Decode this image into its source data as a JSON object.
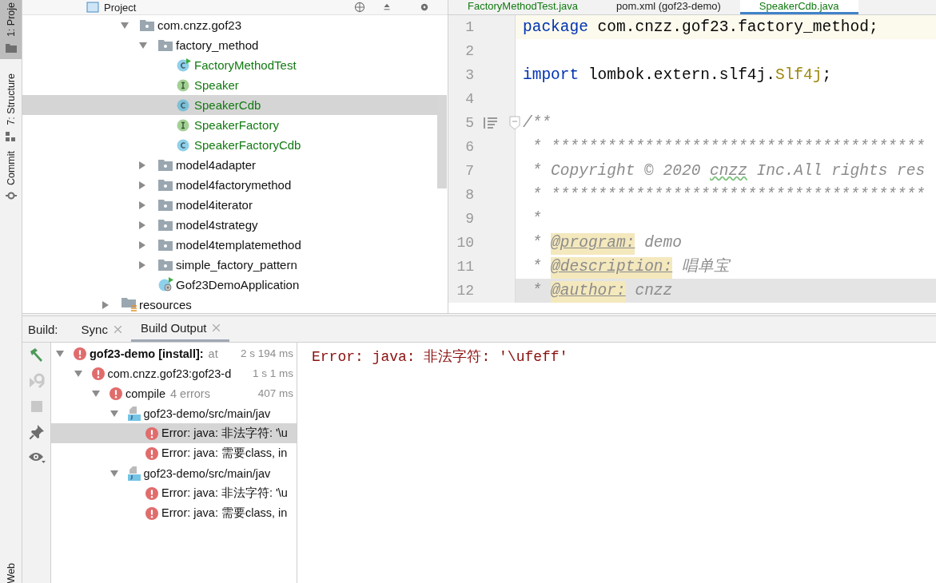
{
  "tool_stripe": [
    {
      "label": "1: Proje",
      "kind": "folder",
      "selected": true
    },
    {
      "label": "7: Structure",
      "kind": "structure",
      "selected": false
    },
    {
      "label": "Commit",
      "kind": "commit",
      "selected": false
    },
    {
      "label": "Web",
      "kind": "plain",
      "selected": false
    }
  ],
  "project_panel": {
    "title": "Project",
    "tree": [
      {
        "label": "com.cnzz.gof23",
        "kind": "package",
        "added": false,
        "selected": false,
        "expanded": true,
        "children": [
          {
            "label": "factory_method",
            "kind": "package",
            "added": false,
            "selected": false,
            "expanded": true,
            "children": [
              {
                "label": "FactoryMethodTest",
                "kind": "test-class",
                "added": true,
                "selected": false
              },
              {
                "label": "Speaker",
                "kind": "interface",
                "added": true,
                "selected": false
              },
              {
                "label": "SpeakerCdb",
                "kind": "class",
                "added": true,
                "selected": true
              },
              {
                "label": "SpeakerFactory",
                "kind": "interface",
                "added": true,
                "selected": false
              },
              {
                "label": "SpeakerFactoryCdb",
                "kind": "class",
                "added": true,
                "selected": false
              }
            ]
          },
          {
            "label": "model4adapter",
            "kind": "package",
            "added": false,
            "selected": false,
            "expanded": false
          },
          {
            "label": "model4factorymethod",
            "kind": "package",
            "added": false,
            "selected": false,
            "expanded": false
          },
          {
            "label": "model4iterator",
            "kind": "package",
            "added": false,
            "selected": false,
            "expanded": false
          },
          {
            "label": "model4strategy",
            "kind": "package",
            "added": false,
            "selected": false,
            "expanded": false
          },
          {
            "label": "model4templatemethod",
            "kind": "package",
            "added": false,
            "selected": false,
            "expanded": false
          },
          {
            "label": "simple_factory_pattern",
            "kind": "package",
            "added": false,
            "selected": false,
            "expanded": false
          },
          {
            "label": "Gof23DemoApplication",
            "kind": "app-class",
            "added": false,
            "selected": false
          }
        ]
      }
    ],
    "outer_items": [
      {
        "label": "resources",
        "kind": "resources",
        "added": false,
        "selected": false,
        "expanded": false
      }
    ]
  },
  "editor": {
    "tabs": [
      {
        "label": "FactoryMethodTest.java",
        "added": true,
        "selected": false
      },
      {
        "label": "pom.xml (gof23-demo)",
        "added": false,
        "selected": false
      },
      {
        "label": "SpeakerCdb.java",
        "added": true,
        "selected": true
      }
    ],
    "lines": [
      {
        "number": "1",
        "current": true,
        "hovered": false,
        "foldable": false,
        "tokens": [
          {
            "kind": "keyword",
            "text": "package"
          },
          {
            "kind": "plain",
            "text": " com.cnzz.gof23.factory_method;"
          }
        ]
      },
      {
        "number": "2",
        "current": false,
        "hovered": false,
        "foldable": false
      },
      {
        "number": "3",
        "current": false,
        "hovered": false,
        "foldable": false,
        "tokens": [
          {
            "kind": "keyword",
            "text": "import"
          },
          {
            "kind": "plain",
            "text": " lombok.extern.slf4j."
          },
          {
            "kind": "annotation",
            "text": "Slf4j"
          },
          {
            "kind": "plain",
            "text": ";"
          }
        ]
      },
      {
        "number": "4",
        "current": false,
        "hovered": false,
        "foldable": false
      },
      {
        "number": "5",
        "current": false,
        "hovered": false,
        "foldable": true,
        "tokens": [
          {
            "kind": "comment",
            "text": "/**"
          }
        ]
      },
      {
        "number": "6",
        "current": false,
        "hovered": false,
        "foldable": false,
        "tokens": [
          {
            "kind": "comment",
            "text": " * ****************************************"
          }
        ]
      },
      {
        "number": "7",
        "current": false,
        "hovered": false,
        "foldable": false,
        "tokens": [
          {
            "kind": "comment",
            "text": " * Copyright © 2020 "
          },
          {
            "kind": "typo",
            "text": "cnzz"
          },
          {
            "kind": "comment",
            "text": " Inc.All rights res"
          }
        ]
      },
      {
        "number": "8",
        "current": false,
        "hovered": false,
        "foldable": false,
        "tokens": [
          {
            "kind": "comment",
            "text": " * ****************************************"
          }
        ]
      },
      {
        "number": "9",
        "current": false,
        "hovered": false,
        "foldable": false,
        "tokens": [
          {
            "kind": "comment",
            "text": " *"
          }
        ]
      },
      {
        "number": "10",
        "current": false,
        "hovered": false,
        "foldable": false,
        "tokens": [
          {
            "kind": "comment",
            "text": " * "
          },
          {
            "kind": "doctag",
            "text": "@program:"
          },
          {
            "kind": "comment",
            "text": " demo"
          }
        ]
      },
      {
        "number": "11",
        "current": false,
        "hovered": false,
        "foldable": false,
        "tokens": [
          {
            "kind": "comment",
            "text": " * "
          },
          {
            "kind": "doctag",
            "text": "@description:"
          },
          {
            "kind": "comment",
            "text": " 唱单宝"
          }
        ]
      },
      {
        "number": "12",
        "current": false,
        "hovered": true,
        "foldable": false,
        "tokens": [
          {
            "kind": "comment",
            "text": " * "
          },
          {
            "kind": "doctag",
            "text": "@author:"
          },
          {
            "kind": "comment",
            "text": " cnzz"
          }
        ]
      }
    ]
  },
  "build": {
    "label": "Build:",
    "tabs": [
      {
        "label": "Sync",
        "selected": false
      },
      {
        "label": "Build Output",
        "selected": true
      }
    ],
    "toolbar": [
      {
        "kind": "hammer",
        "disabled": false
      },
      {
        "kind": "rerun",
        "disabled": true
      },
      {
        "kind": "stop",
        "disabled": true
      },
      {
        "kind": "pin",
        "disabled": false
      },
      {
        "kind": "eye",
        "disabled": false
      }
    ],
    "tree": [
      {
        "kind": "error",
        "label": "gof23-demo [install]:",
        "detail": "at",
        "time": "2 s 194 ms",
        "selected": false,
        "expanded": true,
        "children": [
          {
            "kind": "error",
            "label": "com.cnzz.gof23:gof23-d",
            "time": "1 s 1 ms",
            "selected": false,
            "expanded": true,
            "children": [
              {
                "kind": "error",
                "label": "compile",
                "detail": "4 errors",
                "time": "407 ms",
                "selected": false,
                "expanded": true,
                "children": [
                  {
                    "kind": "java-file",
                    "label": "gof23-demo/src/main/jav",
                    "selected": false,
                    "expanded": true,
                    "children": [
                      {
                        "kind": "error",
                        "label": "Error: java: 非法字符: '\\u",
                        "selected": true
                      },
                      {
                        "kind": "error",
                        "label": "Error: java: 需要class, in",
                        "selected": false
                      }
                    ]
                  },
                  {
                    "kind": "java-file",
                    "label": "gof23-demo/src/main/jav",
                    "selected": false,
                    "expanded": true,
                    "children": [
                      {
                        "kind": "error",
                        "label": "Error: java: 非法字符: '\\u",
                        "selected": false
                      },
                      {
                        "kind": "error",
                        "label": "Error: java: 需要class, in",
                        "selected": false
                      }
                    ]
                  }
                ]
              }
            ]
          }
        ]
      }
    ],
    "console": "Error: java: 非法字符: '\\ufeff'"
  }
}
